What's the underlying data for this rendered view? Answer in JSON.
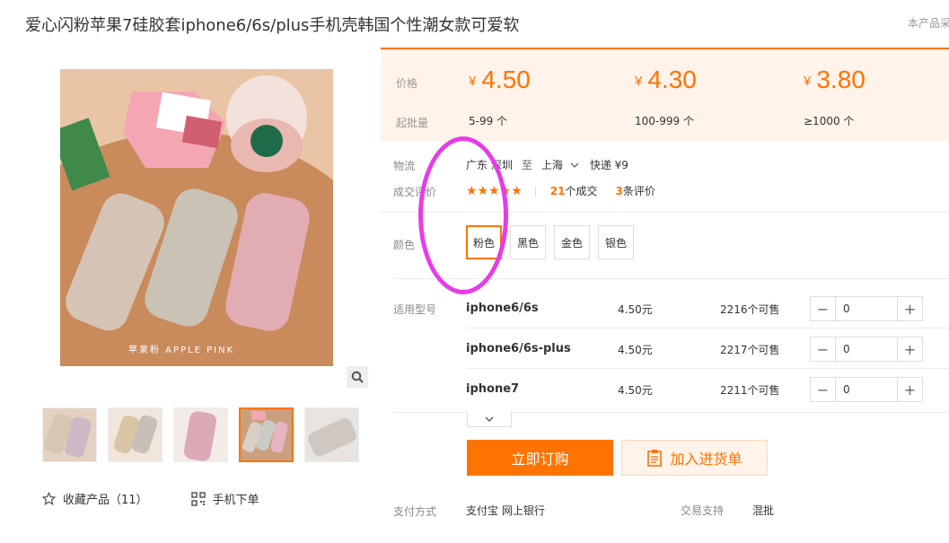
{
  "product": {
    "title": "爱心闪粉苹果7硅胶套iphone6/6s/plus手机壳韩国个性潮女款可爱软",
    "title_right": "本产品采"
  },
  "gallery": {
    "image_caption": "苹果粉 APPLE PINK",
    "zoom_icon": "search-icon",
    "thumb_count": 5,
    "active_thumb": 4
  },
  "left_actions": {
    "favorite_label": "收藏产品（11）",
    "mobile_label": "手机下单"
  },
  "price_box": {
    "price_label": "价格",
    "min_qty_label": "起批量",
    "tiers": [
      {
        "currency": "¥",
        "price": "4.50",
        "range": "5-99 个"
      },
      {
        "currency": "¥",
        "price": "4.30",
        "range": "100-999 个"
      },
      {
        "currency": "¥",
        "price": "3.80",
        "range": "≥1000 个"
      }
    ]
  },
  "logistics": {
    "label": "物流",
    "from": "广东 深圳",
    "to_word": "至",
    "dest": "上海",
    "shipping": "快递 ¥9"
  },
  "deal": {
    "label": "成交评价",
    "stars": "★★★★★",
    "deals_count": "21",
    "deals_unit": "个成交",
    "reviews_count": "3",
    "reviews_unit": "条评价"
  },
  "color": {
    "label": "颜色",
    "options": [
      "粉色",
      "黑色",
      "金色",
      "银色"
    ],
    "selected": "粉色"
  },
  "models": {
    "label": "适用型号",
    "rows": [
      {
        "name": "iphone6/6s",
        "price": "4.50元",
        "stock": "2216个可售",
        "qty": "0"
      },
      {
        "name": "iphone6/6s-plus",
        "price": "4.50元",
        "stock": "2217个可售",
        "qty": "0"
      },
      {
        "name": "iphone7",
        "price": "4.50元",
        "stock": "2211个可售",
        "qty": "0"
      }
    ]
  },
  "actions": {
    "order_label": "立即订购",
    "cart_label": "加入进货单"
  },
  "payment": {
    "label": "支付方式",
    "methods": "支付宝  网上银行",
    "support_label": "交易支持",
    "support_value": "混批"
  },
  "colors_hex": {
    "accent": "#ff7300",
    "price_bg": "#fff3ea",
    "annotation": "#e83be8"
  }
}
